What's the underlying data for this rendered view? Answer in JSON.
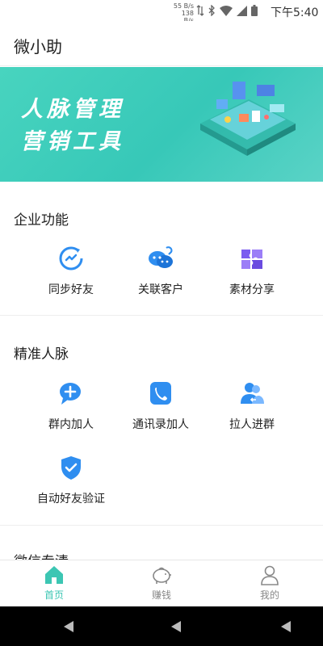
{
  "status_bar": {
    "speed_up": "55 B/s",
    "speed_down": "138 B/s",
    "time": "下午5:40"
  },
  "header": {
    "title": "微小助"
  },
  "banner": {
    "line1": "人脉管理",
    "line2": "营销工具"
  },
  "sections": {
    "enterprise": {
      "title": "企业功能",
      "items": [
        {
          "label": "同步好友",
          "icon": "sync-friends-icon"
        },
        {
          "label": "关联客户",
          "icon": "link-customers-icon"
        },
        {
          "label": "素材分享",
          "icon": "material-share-icon"
        }
      ]
    },
    "precise": {
      "title": "精准人脉",
      "items": [
        {
          "label": "群内加人",
          "icon": "group-add-icon"
        },
        {
          "label": "通讯录加人",
          "icon": "contacts-add-icon"
        },
        {
          "label": "拉人进群",
          "icon": "invite-to-group-icon"
        },
        {
          "label": "自动好友验证",
          "icon": "auto-verify-icon"
        }
      ]
    },
    "wechat": {
      "title": "微信专清"
    }
  },
  "tab_bar": {
    "tabs": [
      {
        "label": "首页",
        "icon": "home-icon",
        "active": true
      },
      {
        "label": "赚钱",
        "icon": "piggy-bank-icon",
        "active": false
      },
      {
        "label": "我的",
        "icon": "profile-icon",
        "active": false
      }
    ]
  },
  "colors": {
    "accent": "#3cc6b3",
    "icon_blue": "#2f8ef0",
    "icon_purple": "#7b5cf0",
    "tab_inactive": "#888888"
  }
}
